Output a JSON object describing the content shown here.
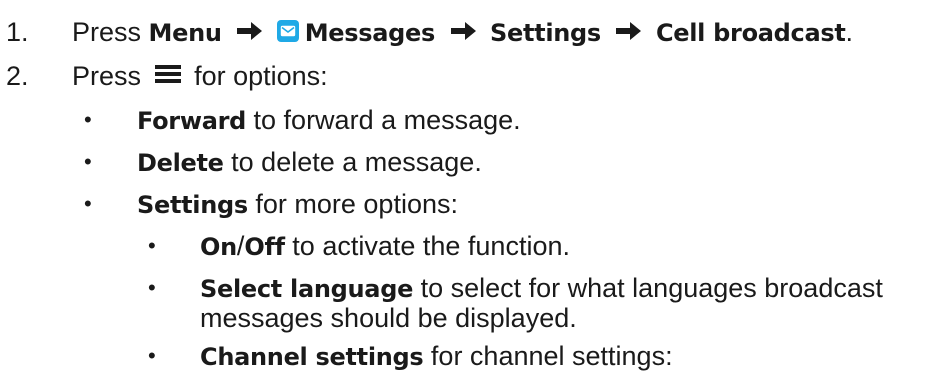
{
  "steps": [
    {
      "number": "1.",
      "press": "Press",
      "menu": "Menu",
      "messages": "Messages",
      "settings": "Settings",
      "cell_broadcast": "Cell broadcast",
      "period": "."
    },
    {
      "number": "2.",
      "press": "Press",
      "rest": "for options:"
    }
  ],
  "options": [
    {
      "term": "Forward",
      "desc": " to forward a message."
    },
    {
      "term": "Delete",
      "desc": " to delete a message."
    },
    {
      "term": "Settings",
      "desc": " for more options:"
    }
  ],
  "settings_options": {
    "on": "On",
    "slash": "/",
    "off": "Off",
    "on_off_desc": " to activate the function.",
    "select_language": "Select language",
    "select_language_desc": " to select for what languages broadcast",
    "select_language_desc_cont": "messages should be displayed.",
    "channel_settings": "Channel settings",
    "channel_settings_desc": " for channel settings:"
  },
  "bullet_char": "•",
  "icons": {
    "arrow": "right-arrow-icon",
    "messages": "envelope-icon",
    "options": "hamburger-menu-icon"
  },
  "colors": {
    "text": "#1a1a1a",
    "message_icon": "#1fa9e6"
  }
}
